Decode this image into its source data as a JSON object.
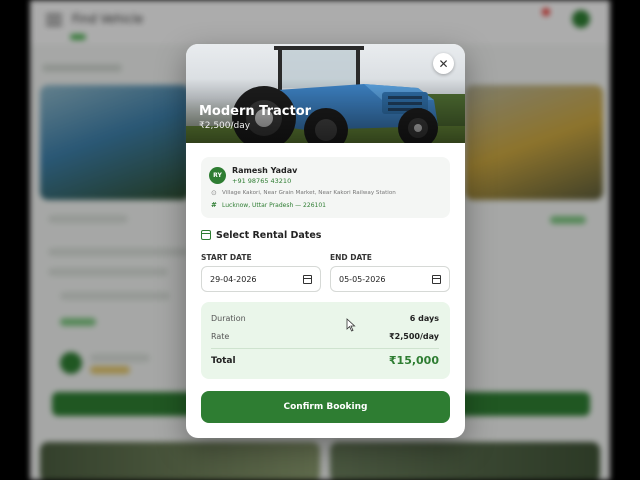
{
  "background": {
    "app_title": "Find Vehicle"
  },
  "modal": {
    "vehicle_name": "Modern Tractor",
    "vehicle_price": "₹2,500/day",
    "close_icon": "close-icon",
    "owner": {
      "initials": "RY",
      "name": "Ramesh Yadav",
      "phone": "+91 98765 43210",
      "address": "Village Kakori, Near Grain Market, Near Kakori Railway Station",
      "location": "Lucknow, Uttar Pradesh — 226101"
    },
    "rental": {
      "section_title": "Select Rental Dates",
      "start_label": "START DATE",
      "start_value": "29-04-2026",
      "end_label": "END DATE",
      "end_value": "05-05-2026"
    },
    "summary": {
      "duration_label": "Duration",
      "duration_value": "6 days",
      "rate_label": "Rate",
      "rate_value": "₹2,500/day",
      "total_label": "Total",
      "total_value": "₹15,000"
    },
    "confirm_label": "Confirm Booking"
  },
  "colors": {
    "primary_green": "#2e7d32",
    "summary_bg": "#eaf6ea",
    "overlay": "rgba(0,0,0,0.30)"
  }
}
